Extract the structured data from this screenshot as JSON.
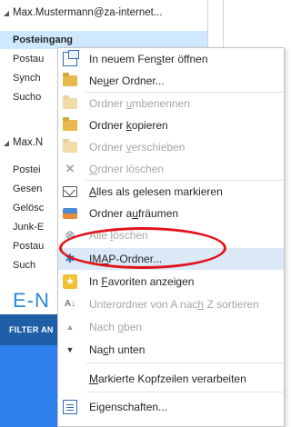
{
  "folder_pane": {
    "account1": "Max.Mustermann@za-internet...",
    "account1_items": [
      "Posteingang",
      "Postau",
      "Synch",
      "Sucho"
    ],
    "account2": "Max.N",
    "account2_items": [
      "Postei",
      "Gesen",
      "Gelösc",
      "Junk-E",
      "Postau",
      "Such"
    ],
    "enote_partial": "E-N",
    "filter_partial": "FILTER AN"
  },
  "context_menu": {
    "items": [
      {
        "label_pre": "In neuem Fen",
        "label_u": "s",
        "label_post": "ter öffnen",
        "icon": "new-window-icon",
        "disabled": false
      },
      {
        "label_pre": "Ne",
        "label_u": "u",
        "label_post": "er Ordner...",
        "icon": "new-folder-icon",
        "disabled": false
      },
      {
        "label_pre": "Ordner ",
        "label_u": "u",
        "label_post": "mbenennen",
        "icon": "rename-folder-icon",
        "disabled": true
      },
      {
        "label_pre": "Ordner ",
        "label_u": "k",
        "label_post": "opieren",
        "icon": "copy-folder-icon",
        "disabled": false
      },
      {
        "label_pre": "Ordner ",
        "label_u": "v",
        "label_post": "erschieben",
        "icon": "move-folder-icon",
        "disabled": true
      },
      {
        "label_pre": "",
        "label_u": "O",
        "label_post": "rdner löschen",
        "icon": "delete-folder-icon",
        "disabled": true
      },
      {
        "label_pre": "",
        "label_u": "A",
        "label_post": "lles als gelesen markieren",
        "icon": "mark-read-icon",
        "disabled": false
      },
      {
        "label_pre": "Ordner a",
        "label_u": "u",
        "label_post": "fräumen",
        "icon": "clean-up-icon",
        "disabled": false
      },
      {
        "label_pre": "Alle ",
        "label_u": "l",
        "label_post": "öschen",
        "icon": "delete-all-icon",
        "disabled": true
      },
      {
        "label_pre": "IM",
        "label_u": "A",
        "label_post": "P-Ordner...",
        "icon": "imap-gear-icon",
        "disabled": false
      },
      {
        "label_pre": "In ",
        "label_u": "F",
        "label_post": "avoriten anzeigen",
        "icon": "favorites-star-icon",
        "disabled": false
      },
      {
        "label_pre": "Unterordner von A nac",
        "label_u": "h",
        "label_post": " Z sortieren",
        "icon": "sort-az-icon",
        "disabled": true
      },
      {
        "label_pre": "Nach ",
        "label_u": "o",
        "label_post": "ben",
        "icon": "arrow-up-icon",
        "disabled": true
      },
      {
        "label_pre": "Na",
        "label_u": "c",
        "label_post": "h unten",
        "icon": "arrow-down-icon",
        "disabled": false
      },
      {
        "label_pre": "",
        "label_u": "M",
        "label_post": "arkierte Kopfzeilen verarbeiten",
        "icon": "",
        "disabled": false
      },
      {
        "label_pre": "Eigenschaften...",
        "label_u": "",
        "label_post": "",
        "icon": "properties-icon",
        "disabled": false
      }
    ]
  }
}
